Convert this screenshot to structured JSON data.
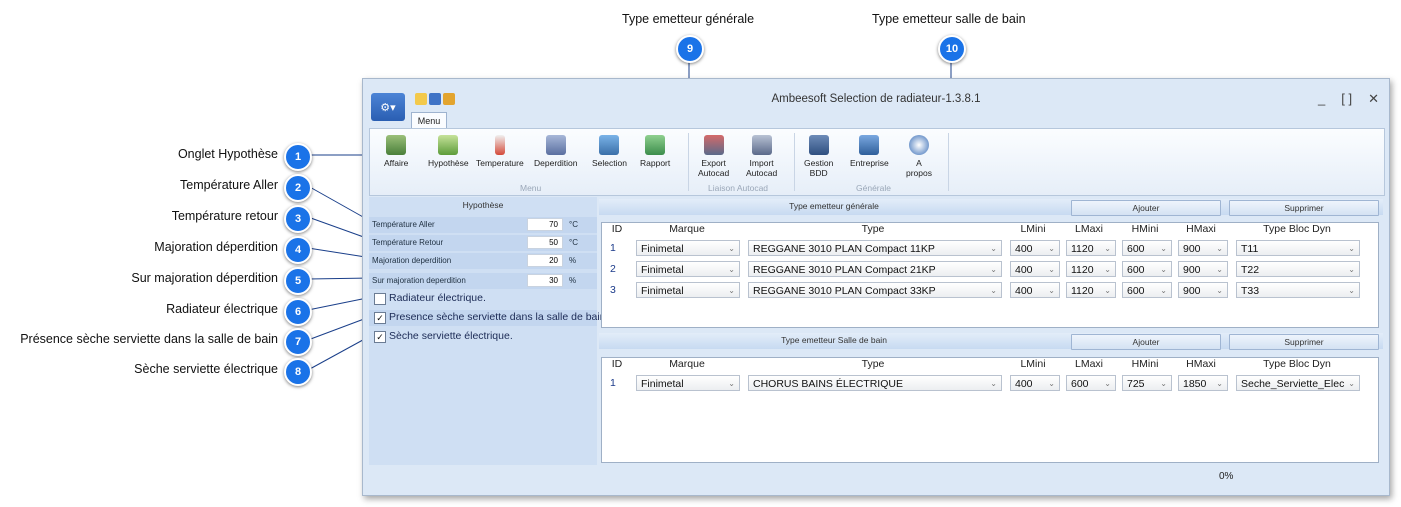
{
  "callouts": [
    {
      "num": "1",
      "label": "Onglet Hypothèse"
    },
    {
      "num": "2",
      "label": "Température Aller"
    },
    {
      "num": "3",
      "label": "Température retour"
    },
    {
      "num": "4",
      "label": "Majoration déperdition"
    },
    {
      "num": "5",
      "label": "Sur majoration déperdition"
    },
    {
      "num": "6",
      "label": "Radiateur électrique"
    },
    {
      "num": "7",
      "label": "Présence sèche serviette dans la salle de bain"
    },
    {
      "num": "8",
      "label": "Sèche serviette électrique"
    },
    {
      "num": "9",
      "label": "Type emetteur générale"
    },
    {
      "num": "10",
      "label": "Type emetteur salle de bain"
    }
  ],
  "window": {
    "title": "Ambeesoft Selection de radiateur-1.3.8.1",
    "controls": {
      "minimize": "_",
      "maximize": "[ ]",
      "close": "✕"
    },
    "tab": "Menu"
  },
  "ribbon": {
    "menu_group": {
      "label": "Menu",
      "buttons": [
        "Affaire",
        "Hypothèse",
        "Temperature",
        "Deperdition",
        "Selection",
        "Rapport"
      ]
    },
    "autocad_group": {
      "label": "Liaison Autocad",
      "export": "Export\nAutocad",
      "export_l1": "Export",
      "export_l2": "Autocad",
      "import_l1": "Import",
      "import_l2": "Autocad"
    },
    "general_group": {
      "label": "Générale",
      "gestion_l1": "Gestion",
      "gestion_l2": "BDD",
      "entreprise": "Entreprise",
      "apropos_l1": "A",
      "apropos_l2": "propos"
    }
  },
  "hypothese": {
    "header": "Hypothèse",
    "rows": [
      {
        "label": "Température Aller",
        "value": "70",
        "unit": "°C"
      },
      {
        "label": "Température Retour",
        "value": "50",
        "unit": "°C"
      },
      {
        "label": "Majoration deperdition",
        "value": "20",
        "unit": "%"
      },
      {
        "label": "Sur majoration deperdition",
        "value": "30",
        "unit": "%"
      }
    ],
    "checks": [
      {
        "label": "Radiateur électrique.",
        "checked": false,
        "mark": ""
      },
      {
        "label": "Presence sèche serviette dans la salle de bain",
        "checked": true,
        "mark": "✓"
      },
      {
        "label": "Sèche serviette électrique.",
        "checked": true,
        "mark": "✓"
      }
    ]
  },
  "section_general": {
    "title": "Type emetteur générale",
    "add": "Ajouter",
    "remove": "Supprimer"
  },
  "section_bath": {
    "title": "Type emetteur Salle de bain",
    "add": "Ajouter",
    "remove": "Supprimer"
  },
  "columns": [
    "ID",
    "Marque",
    "Type",
    "LMini",
    "LMaxi",
    "HMini",
    "HMaxi",
    "Type Bloc Dyn"
  ],
  "general_rows": [
    {
      "id": "1",
      "marque": "Finimetal",
      "type": "REGGANE 3010 PLAN Compact 11KP",
      "lmini": "400",
      "lmaxi": "1120",
      "hmini": "600",
      "hmaxi": "900",
      "bloc": "T11"
    },
    {
      "id": "2",
      "marque": "Finimetal",
      "type": "REGGANE 3010 PLAN Compact 21KP",
      "lmini": "400",
      "lmaxi": "1120",
      "hmini": "600",
      "hmaxi": "900",
      "bloc": "T22"
    },
    {
      "id": "3",
      "marque": "Finimetal",
      "type": "REGGANE 3010 PLAN Compact 33KP",
      "lmini": "400",
      "lmaxi": "1120",
      "hmini": "600",
      "hmaxi": "900",
      "bloc": "T33"
    }
  ],
  "bath_rows": [
    {
      "id": "1",
      "marque": "Finimetal",
      "type": "CHORUS BAINS ÉLECTRIQUE",
      "lmini": "400",
      "lmaxi": "600",
      "hmini": "725",
      "hmaxi": "1850",
      "bloc": "Seche_Serviette_Elec"
    }
  ],
  "status": {
    "progress": "0%"
  },
  "colors": {
    "badge": "#1a73e8",
    "panel": "#cfdff3",
    "window": "#dce8f6"
  },
  "icons": [
    "app-menu-icon",
    "affaire-icon",
    "hypothese-icon",
    "temperature-icon",
    "deperdition-icon",
    "selection-icon",
    "rapport-icon",
    "export-icon",
    "import-icon",
    "database-icon",
    "entreprise-icon",
    "help-icon"
  ]
}
